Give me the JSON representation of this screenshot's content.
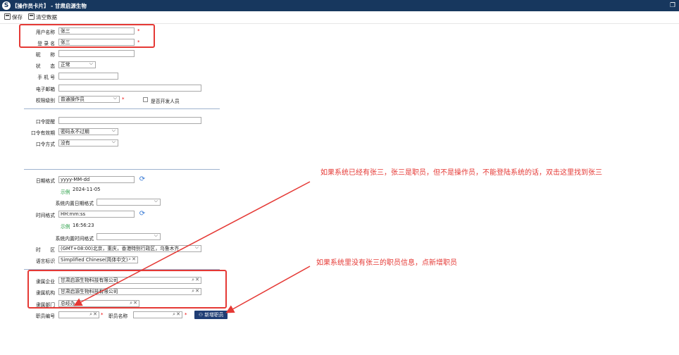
{
  "window": {
    "logo": "S",
    "title": "【操作员卡片】 - 甘肃启源生物",
    "window_button_icon": "restore-icon"
  },
  "toolbar": {
    "save": "保存",
    "clear": "清空数据"
  },
  "form": {
    "username": {
      "label": "用户名称",
      "value": "张三"
    },
    "login": {
      "label": "登 录 名",
      "value": "张三"
    },
    "nickname": {
      "label": "昵　　称",
      "value": ""
    },
    "status": {
      "label": "状　　态",
      "value": "正常"
    },
    "phone": {
      "label": "手 机 号",
      "value": ""
    },
    "email": {
      "label": "电子邮箱",
      "value": ""
    },
    "permission": {
      "label": "权限级别",
      "value": "普通操作员"
    },
    "is_developer": {
      "label": "是否开发人员",
      "checked": false
    },
    "pwd_hint": {
      "label": "口令提醒",
      "value": ""
    },
    "pwd_validity": {
      "label": "口令有效期",
      "value": "密码永不过期"
    },
    "pwd_method": {
      "label": "口令方式",
      "value": "没有"
    },
    "date_format": {
      "label": "日期格式",
      "value": "yyyy-MM-dd",
      "example_label": "示例",
      "example_value": "2024-11-05"
    },
    "sys_date_format": {
      "label": "系统内置日期格式",
      "value": ""
    },
    "time_format": {
      "label": "时间格式",
      "value": "HH:mm:ss",
      "example_label": "示例",
      "example_value": "16:56:23"
    },
    "sys_time_format": {
      "label": "系统内置时间格式",
      "value": ""
    },
    "timezone": {
      "label": "时　　区",
      "value": "(GMT+08:00)北京，重庆，香港特别行政区，乌鲁木齐"
    },
    "language": {
      "label": "语言标识",
      "value": "Simplified Chinese(简体中文)"
    },
    "company": {
      "label": "隶属企业",
      "value": "甘肃启源生物科技有限公司"
    },
    "org": {
      "label": "隶属机构",
      "value": "甘肃启源生物科技有限公司"
    },
    "dept": {
      "label": "隶属部门",
      "value": "总经办"
    },
    "emp_no": {
      "label": "职员编号",
      "value": ""
    },
    "emp_name": {
      "label": "职员名称",
      "value": ""
    },
    "add_employee": "新增职员",
    "required_mark": "*"
  },
  "annotations": {
    "note1": "如果系统已经有张三，张三是职员，但不是操作员，不能登陆系统的话，双击这里找到张三",
    "note2": "如果系统里没有张三的职员信息，点新增职员"
  },
  "colors": {
    "titlebar": "#17375e",
    "annotation": "#e53935",
    "accent_button": "#1f3d74",
    "example_text": "#1e9a3c"
  }
}
